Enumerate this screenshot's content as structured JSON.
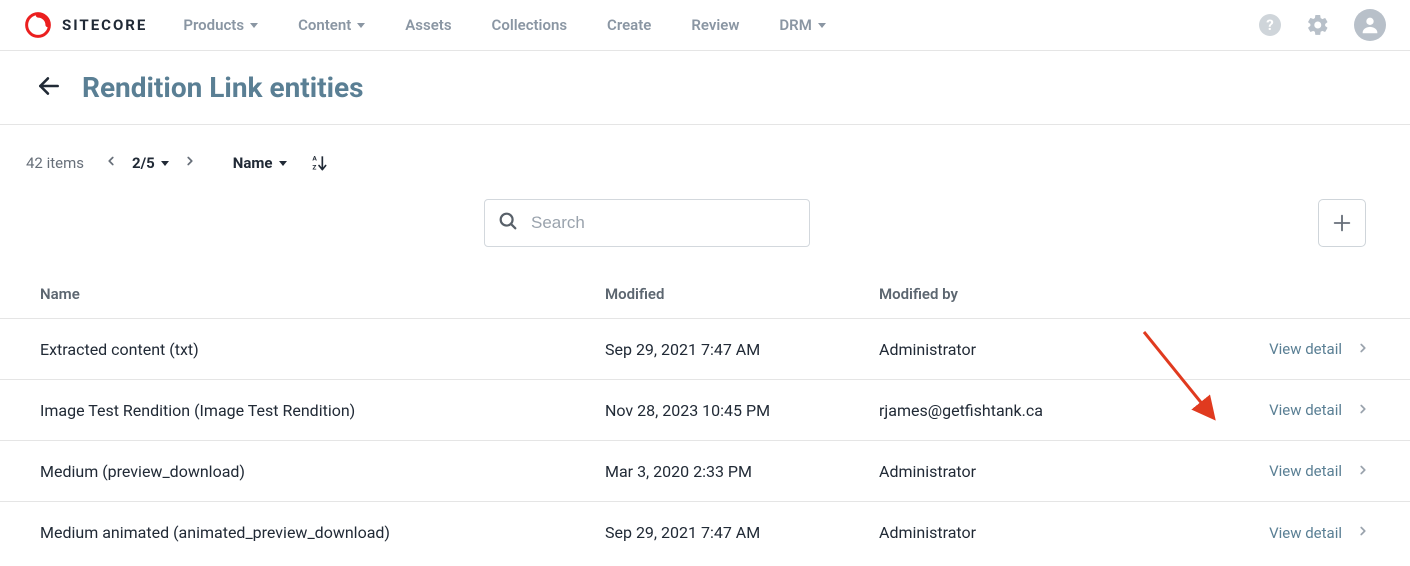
{
  "brand": {
    "name": "SITECORE"
  },
  "nav": {
    "items": [
      {
        "label": "Products",
        "hasDropdown": true
      },
      {
        "label": "Content",
        "hasDropdown": true
      },
      {
        "label": "Assets",
        "hasDropdown": false
      },
      {
        "label": "Collections",
        "hasDropdown": false
      },
      {
        "label": "Create",
        "hasDropdown": false
      },
      {
        "label": "Review",
        "hasDropdown": false
      },
      {
        "label": "DRM",
        "hasDropdown": true
      }
    ]
  },
  "header": {
    "title": "Rendition Link entities"
  },
  "toolbar": {
    "item_count": "42 items",
    "page_indicator": "2/5",
    "sort_label": "Name"
  },
  "search": {
    "placeholder": "Search"
  },
  "table": {
    "columns": [
      "Name",
      "Modified",
      "Modified by"
    ],
    "view_label": "View detail",
    "rows": [
      {
        "name": "Extracted content (txt)",
        "modified": "Sep 29, 2021 7:47 AM",
        "modified_by": "Administrator"
      },
      {
        "name": "Image Test Rendition (Image Test Rendition)",
        "modified": "Nov 28, 2023 10:45 PM",
        "modified_by": "rjames@getfishtank.ca"
      },
      {
        "name": "Medium (preview_download)",
        "modified": "Mar 3, 2020 2:33 PM",
        "modified_by": "Administrator"
      },
      {
        "name": "Medium animated (animated_preview_download)",
        "modified": "Sep 29, 2021 7:47 AM",
        "modified_by": "Administrator"
      }
    ]
  }
}
